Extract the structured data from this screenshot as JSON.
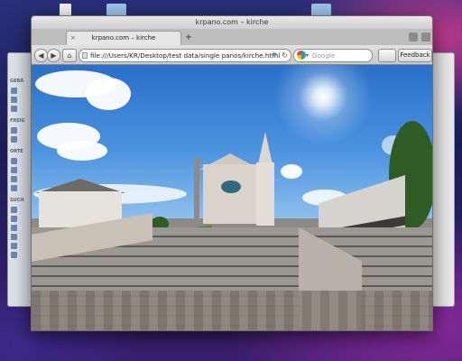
{
  "browser": {
    "window_title": "krpano.com – kirche",
    "tab_title": "krpano.com – kirche",
    "tab_close": "×",
    "new_tab": "+",
    "back": "◀",
    "forward": "▶",
    "home": "⌂",
    "url": "file:///Users/KR/Desktop/test data/single panos/kirche.html",
    "bookmark_star": "★",
    "reload": "↻",
    "search_dropdown": "▾",
    "search_placeholder": "Google",
    "feedback_label": "Feedback",
    "feedback_arrow": "▾"
  },
  "finder": {
    "sidebar_headings": [
      "GERÄ",
      "FREIG",
      "ORTE",
      "SUCH"
    ]
  },
  "colors": {
    "desktop_bg": "#1a1d55",
    "sky": "#3d82d8",
    "accent": "#5b7fc9"
  }
}
